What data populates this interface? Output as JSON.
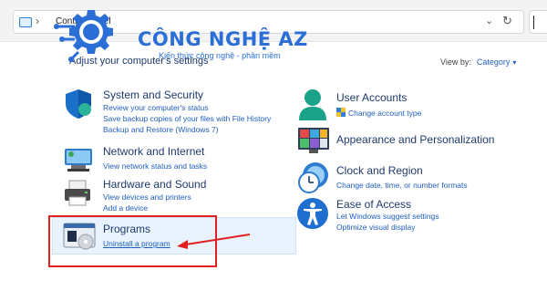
{
  "address_bar": {
    "separator": "›",
    "breadcrumb": "Control Panel",
    "dropdown": "⌄",
    "refresh": "↻"
  },
  "watermark": {
    "brand": "CÔNG NGHỆ AZ",
    "tagline": "Kiến thức công nghệ - phần mềm"
  },
  "header": {
    "title": "Adjust your computer's settings",
    "view_by_label": "View by:",
    "view_by_value": "Category",
    "view_by_arrow": "▾"
  },
  "left_categories": [
    {
      "title": "System and Security",
      "icon": "shield-icon",
      "links": [
        "Review your computer's status",
        "Save backup copies of your files with File History",
        "Backup and Restore (Windows 7)"
      ]
    },
    {
      "title": "Network and Internet",
      "icon": "network-icon",
      "links": [
        "View network status and tasks"
      ]
    },
    {
      "title": "Hardware and Sound",
      "icon": "printer-icon",
      "links": [
        "View devices and printers",
        "Add a device"
      ]
    },
    {
      "title": "Programs",
      "icon": "programs-icon",
      "links": [
        "Uninstall a program"
      ]
    }
  ],
  "right_categories": [
    {
      "title": "User Accounts",
      "icon": "user-icon",
      "links": [
        "Change account type"
      ]
    },
    {
      "title": "Appearance and Personalization",
      "icon": "appearance-icon",
      "links": []
    },
    {
      "title": "Clock and Region",
      "icon": "clock-icon",
      "links": [
        "Change date, time, or number formats"
      ]
    },
    {
      "title": "Ease of Access",
      "icon": "accessibility-icon",
      "links": [
        "Let Windows suggest settings",
        "Optimize visual display"
      ]
    }
  ],
  "colors": {
    "link": "#1f5fbf",
    "title": "#1e3a6e",
    "highlight": "#e8f3fd",
    "annotation": "#e02020",
    "brand": "#2b6fd6"
  }
}
